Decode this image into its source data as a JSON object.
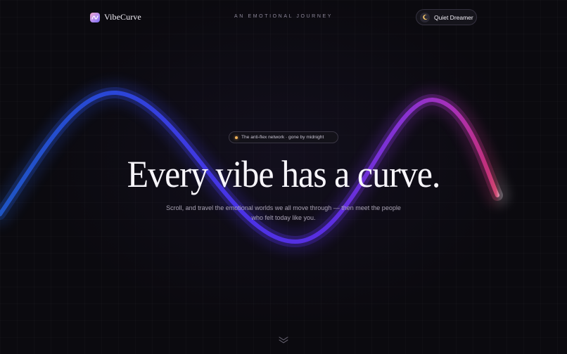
{
  "header": {
    "brand_name": "VibeCurve",
    "tagline": "AN EMOTIONAL JOURNEY",
    "user_pill": {
      "icon": "moon-icon",
      "label": "Quiet Dreamer"
    }
  },
  "hero": {
    "badge": "The anti-flex network · gone by midnight",
    "headline": "Every vibe has a curve.",
    "subcopy": "Scroll, and travel the emotional worlds we all move through — then meet the people who felt today like you.",
    "scroll_icon": "chevron-down-icon"
  },
  "colors": {
    "background": "#0b0a0f",
    "curve_start": "#2354c8",
    "curve_mid": "#4a2fe0",
    "curve_purple": "#9b30c8",
    "curve_end": "#c0305a",
    "badge_dot": "#f0b35a"
  }
}
